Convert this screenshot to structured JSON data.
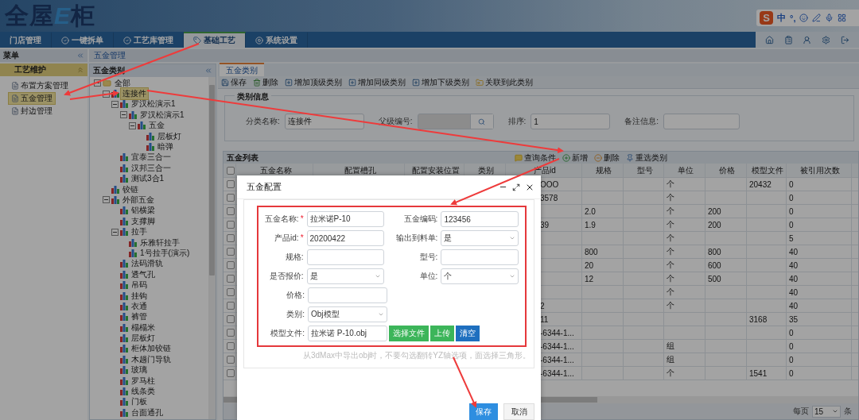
{
  "header": {
    "logo": {
      "main": "全屋",
      "accent": "E",
      "tail": "柜"
    },
    "ime": {
      "logo": "S",
      "mode": "中",
      "punct": "°,"
    }
  },
  "nav": {
    "tabs": [
      {
        "label": "门店管理",
        "selected": false
      },
      {
        "label": "一键拆单",
        "selected": false
      },
      {
        "label": "工艺库管理",
        "selected": false
      },
      {
        "label": "基础工艺",
        "selected": true
      },
      {
        "label": "系统设置",
        "selected": false
      }
    ]
  },
  "menu": {
    "title": "菜单",
    "section": "工艺维护",
    "items": [
      {
        "label": "布置方案管理",
        "selected": false
      },
      {
        "label": "五金管理",
        "selected": true
      },
      {
        "label": "封边管理",
        "selected": false
      }
    ]
  },
  "breadcrumb": "五金管理",
  "tree": {
    "title": "五金类别",
    "nodes": [
      {
        "label": "全部",
        "kind": "folder",
        "selected": false,
        "expanded": true,
        "children": [
          {
            "label": "连接件",
            "kind": "category",
            "selected": true,
            "expanded": true,
            "children": [
              {
                "label": "罗汉松演示1",
                "kind": "category",
                "selected": false,
                "expanded": true,
                "children": [
                  {
                    "label": "罗汉松演示1",
                    "kind": "category",
                    "selected": false,
                    "expanded": true,
                    "children": [
                      {
                        "label": "五金",
                        "kind": "category",
                        "selected": false,
                        "expanded": true,
                        "children": [
                          {
                            "label": "层板灯",
                            "kind": "category",
                            "selected": false
                          },
                          {
                            "label": "暗弹",
                            "kind": "category",
                            "selected": false
                          }
                        ]
                      }
                    ]
                  }
                ]
              },
              {
                "label": "宜泰三合一",
                "kind": "category",
                "selected": false
              },
              {
                "label": "汉邦三合一",
                "kind": "category",
                "selected": false
              },
              {
                "label": "测试3合1",
                "kind": "category",
                "selected": false
              }
            ]
          },
          {
            "label": "铰链",
            "kind": "category",
            "selected": false
          },
          {
            "label": "外部五金",
            "kind": "category",
            "selected": false,
            "expanded": true,
            "children": [
              {
                "label": "铝横梁",
                "kind": "category",
                "selected": false
              },
              {
                "label": "支撑脚",
                "kind": "category",
                "selected": false
              },
              {
                "label": "拉手",
                "kind": "category",
                "selected": false,
                "expanded": true,
                "children": [
                  {
                    "label": "乐雅轩拉手",
                    "kind": "category",
                    "selected": false
                  },
                  {
                    "label": "1号拉手(演示)",
                    "kind": "category",
                    "selected": false
                  }
                ]
              },
              {
                "label": "法码滑轨",
                "kind": "category",
                "selected": false
              },
              {
                "label": "透气孔",
                "kind": "category",
                "selected": false
              },
              {
                "label": "吊码",
                "kind": "category",
                "selected": false
              },
              {
                "label": "挂钩",
                "kind": "category",
                "selected": false
              },
              {
                "label": "衣通",
                "kind": "category",
                "selected": false
              },
              {
                "label": "裤管",
                "kind": "category",
                "selected": false
              },
              {
                "label": "榻榻米",
                "kind": "category",
                "selected": false
              },
              {
                "label": "层板灯",
                "kind": "category",
                "selected": false
              },
              {
                "label": "柜体加铰链",
                "kind": "category",
                "selected": false
              },
              {
                "label": "木趟门导轨",
                "kind": "category",
                "selected": false
              },
              {
                "label": "玻璃",
                "kind": "category",
                "selected": false
              },
              {
                "label": "罗马柱",
                "kind": "category",
                "selected": false
              },
              {
                "label": "线条类",
                "kind": "category",
                "selected": false
              },
              {
                "label": "门板",
                "kind": "category",
                "selected": false
              },
              {
                "label": "台面通孔",
                "kind": "category",
                "selected": false
              }
            ]
          }
        ]
      }
    ]
  },
  "main_tab": {
    "label": "五金类别",
    "selected": true
  },
  "toolbar": [
    "保存",
    "删除",
    "增加顶级类别",
    "增加同级类别",
    "增加下级类别",
    "关联到此类别"
  ],
  "category_form": {
    "legend": "类别信息",
    "fields": [
      {
        "label": "分类名称:",
        "kind": "text",
        "value": "连接件"
      },
      {
        "label": "父级编号:",
        "kind": "lookup",
        "disabled": true
      },
      {
        "label": "排序:",
        "kind": "text",
        "value": "1"
      },
      {
        "label": "备注信息:",
        "kind": "textarea"
      }
    ]
  },
  "grid": {
    "title": "五金列表",
    "actions": [
      "查询条件",
      "新增",
      "删除",
      "重选类别"
    ],
    "header_checked": false,
    "columns": [
      "五金名称",
      "配置槽孔",
      "配置安装位置",
      "类别",
      "产品id",
      "规格",
      "型号",
      "单位",
      "价格",
      "模型文件",
      "被引用次数"
    ],
    "rows": [
      {
        "checked": false,
        "product_id": "OOO",
        "unit": "个",
        "model_file": "20432",
        "references": "0"
      },
      {
        "checked": false,
        "product_id": "3578",
        "unit": "个",
        "references": "0"
      },
      {
        "checked": false,
        "spec": "2.0",
        "unit": "个",
        "price": "200",
        "references": "0"
      },
      {
        "checked": false,
        "product_id": "39",
        "spec": "1.9",
        "unit": "个",
        "price": "200",
        "references": "0"
      },
      {
        "checked": false,
        "unit": "个",
        "references": "5"
      },
      {
        "checked": false,
        "spec": "800",
        "unit": "个",
        "price": "800",
        "references": "40"
      },
      {
        "checked": false,
        "spec": "20",
        "unit": "个",
        "price": "600",
        "references": "40"
      },
      {
        "checked": false,
        "spec": "12",
        "unit": "个",
        "price": "500",
        "references": "40"
      },
      {
        "checked": false,
        "unit": "个",
        "references": "40"
      },
      {
        "checked": false,
        "product_id": "2",
        "unit": "个",
        "references": "40"
      },
      {
        "checked": false,
        "product_id": "11",
        "model_file": "3168",
        "references": "35"
      },
      {
        "checked": false,
        "product_id": "-6344-1...",
        "references": "0"
      },
      {
        "checked": false,
        "product_id": "-6344-1...",
        "unit": "组",
        "references": "0"
      },
      {
        "checked": false,
        "product_id": "-6344-1...",
        "unit": "组",
        "references": "0"
      },
      {
        "checked": false,
        "product_id": "-6344-1...",
        "unit": "个",
        "model_file": "1541",
        "references": "0"
      }
    ],
    "pager": {
      "label": "每页",
      "page_size": "15",
      "suffix": "条"
    }
  },
  "dialog": {
    "title": "五金配置",
    "rows": [
      {
        "fields": [
          {
            "label": "五金名称:",
            "required_mark": "*",
            "kind": "text",
            "value": "拉米诺P-10"
          },
          {
            "label": "五金编码:",
            "kind": "text",
            "value": "123456"
          }
        ]
      },
      {
        "fields": [
          {
            "label": "产品id:",
            "required_mark": "*",
            "kind": "text",
            "value": "20200422"
          },
          {
            "label": "输出到料单:",
            "kind": "select",
            "value": "是"
          }
        ]
      },
      {
        "fields": [
          {
            "label": "规格:",
            "kind": "text"
          },
          {
            "label": "型号:",
            "kind": "text"
          }
        ]
      },
      {
        "fields": [
          {
            "label": "是否报价:",
            "kind": "select",
            "value": "是"
          },
          {
            "label": "单位:",
            "kind": "select",
            "value": "个"
          }
        ]
      },
      {
        "fields": [
          {
            "label": "价格:",
            "kind": "text"
          }
        ]
      },
      {
        "fields": [
          {
            "label": "类别:",
            "kind": "select",
            "value": "Obj模型"
          }
        ]
      },
      {
        "fields": [
          {
            "label": "模型文件:",
            "kind": "file",
            "value": "拉米诺 P-10.obj",
            "buttons": [
              {
                "label": "选择文件",
                "color": "#3cb55a"
              },
              {
                "label": "上传",
                "color": "#3cb55a"
              },
              {
                "label": "清空",
                "color": "#1e6fbf"
              }
            ]
          }
        ]
      }
    ],
    "hint": "从3dMax中导出obj时，不要勾选翻转YZ轴选项，面选择三角形。",
    "buttons": [
      {
        "label": "保存",
        "kind": "primary"
      },
      {
        "label": "取消",
        "kind": "default"
      }
    ]
  }
}
